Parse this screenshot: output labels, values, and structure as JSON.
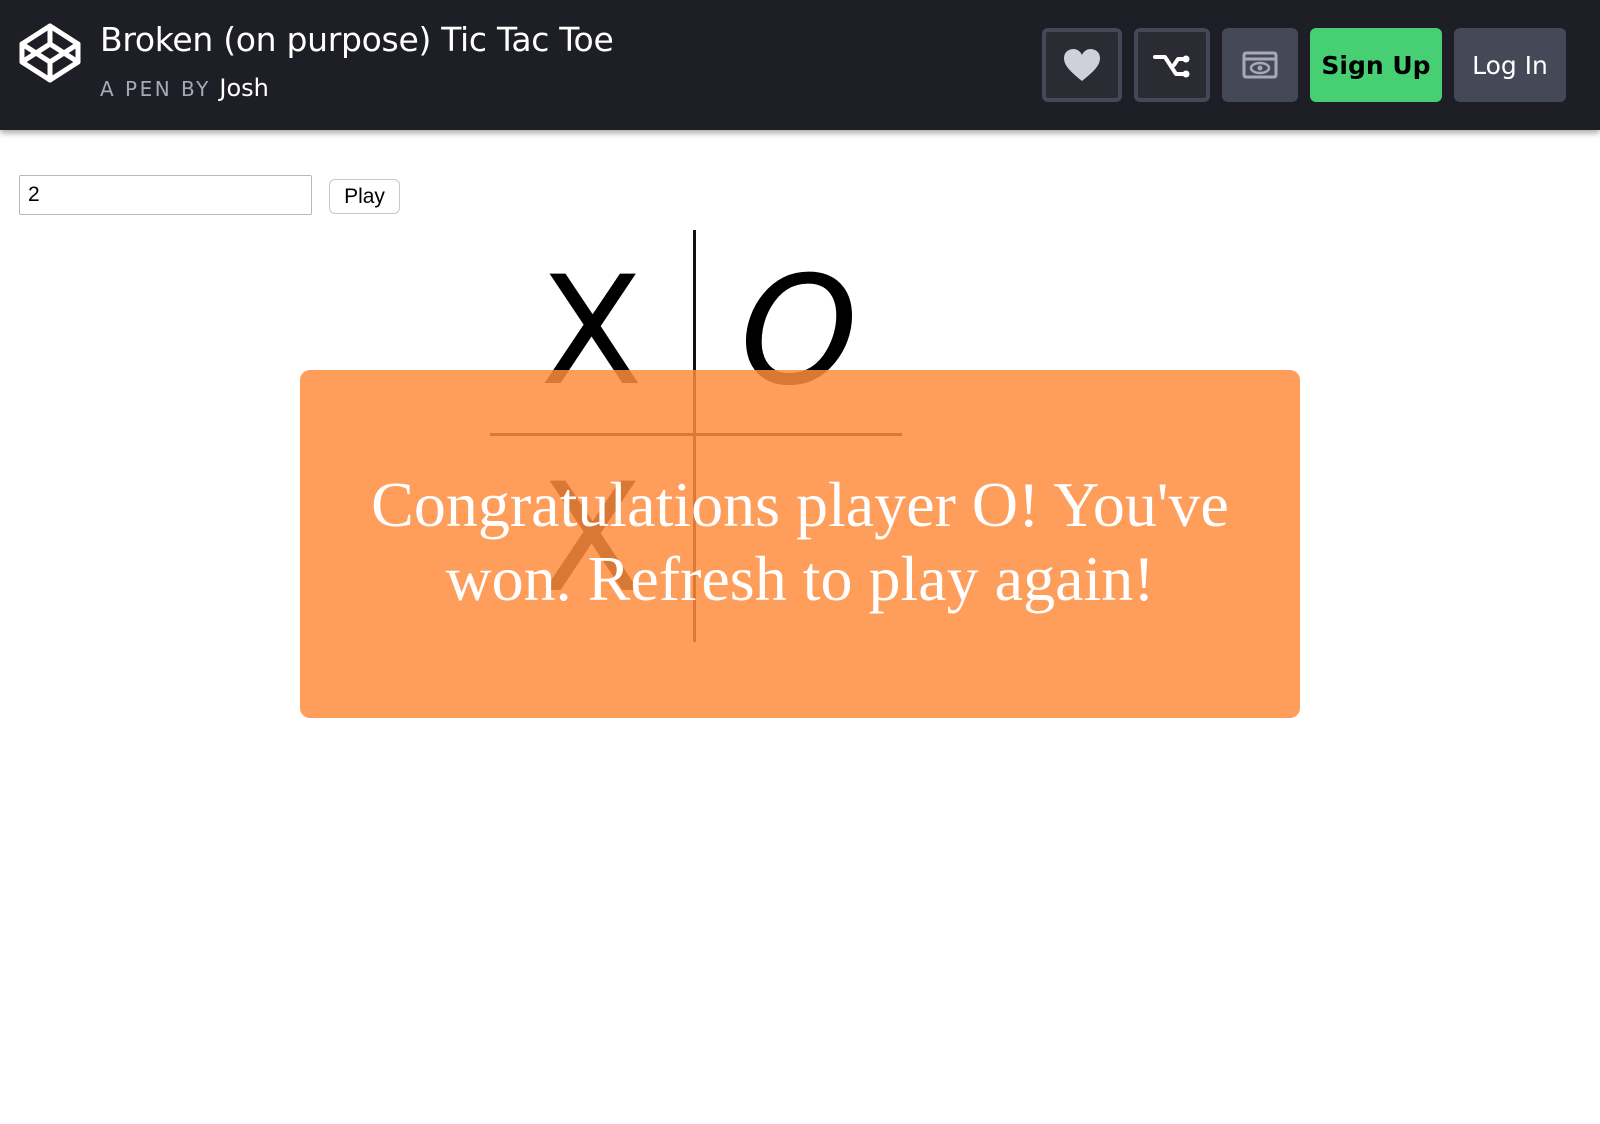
{
  "header": {
    "title": "Broken (on purpose) Tic Tac Toe",
    "by_label": "A PEN BY",
    "author": "Josh",
    "buttons": {
      "heart_icon": "heart-icon",
      "fork_icon": "fork-icon",
      "view_icon": "eye-icon",
      "signup_label": "Sign Up",
      "login_label": "Log In"
    },
    "colors": {
      "background": "#1e1f26",
      "signup": "#47cf73",
      "button": "#444857"
    }
  },
  "controls": {
    "size_value": "2",
    "play_label": "Play"
  },
  "board": {
    "size": 2,
    "cells": [
      "X",
      "O",
      "X",
      ""
    ]
  },
  "overlay": {
    "message": "Congratulations player O! You've won. Refresh to play again!",
    "color": "#ff8c3e"
  }
}
